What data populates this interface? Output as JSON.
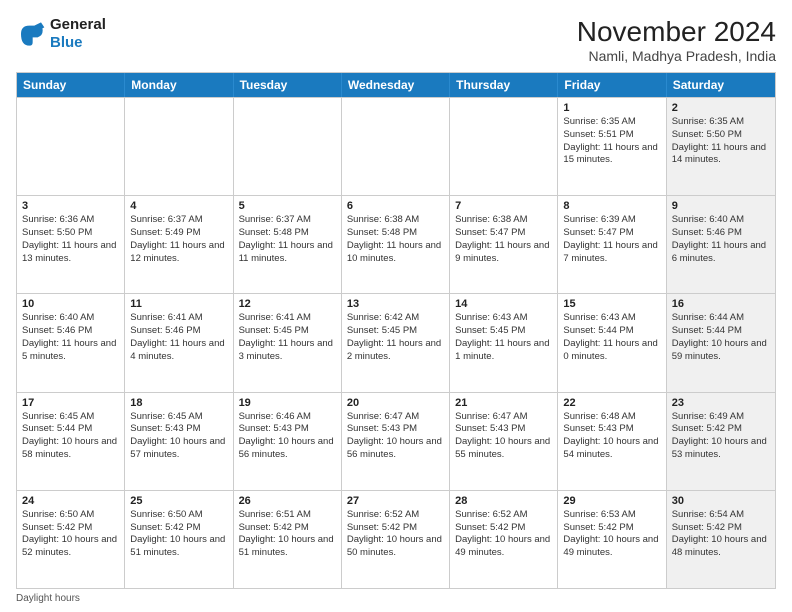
{
  "logo": {
    "line1": "General",
    "line2": "Blue"
  },
  "title": "November 2024",
  "subtitle": "Namli, Madhya Pradesh, India",
  "weekdays": [
    "Sunday",
    "Monday",
    "Tuesday",
    "Wednesday",
    "Thursday",
    "Friday",
    "Saturday"
  ],
  "weeks": [
    [
      {
        "day": "",
        "info": "",
        "shaded": false
      },
      {
        "day": "",
        "info": "",
        "shaded": false
      },
      {
        "day": "",
        "info": "",
        "shaded": false
      },
      {
        "day": "",
        "info": "",
        "shaded": false
      },
      {
        "day": "",
        "info": "",
        "shaded": false
      },
      {
        "day": "1",
        "info": "Sunrise: 6:35 AM\nSunset: 5:51 PM\nDaylight: 11 hours and 15 minutes.",
        "shaded": false
      },
      {
        "day": "2",
        "info": "Sunrise: 6:35 AM\nSunset: 5:50 PM\nDaylight: 11 hours and 14 minutes.",
        "shaded": true
      }
    ],
    [
      {
        "day": "3",
        "info": "Sunrise: 6:36 AM\nSunset: 5:50 PM\nDaylight: 11 hours and 13 minutes.",
        "shaded": false
      },
      {
        "day": "4",
        "info": "Sunrise: 6:37 AM\nSunset: 5:49 PM\nDaylight: 11 hours and 12 minutes.",
        "shaded": false
      },
      {
        "day": "5",
        "info": "Sunrise: 6:37 AM\nSunset: 5:48 PM\nDaylight: 11 hours and 11 minutes.",
        "shaded": false
      },
      {
        "day": "6",
        "info": "Sunrise: 6:38 AM\nSunset: 5:48 PM\nDaylight: 11 hours and 10 minutes.",
        "shaded": false
      },
      {
        "day": "7",
        "info": "Sunrise: 6:38 AM\nSunset: 5:47 PM\nDaylight: 11 hours and 9 minutes.",
        "shaded": false
      },
      {
        "day": "8",
        "info": "Sunrise: 6:39 AM\nSunset: 5:47 PM\nDaylight: 11 hours and 7 minutes.",
        "shaded": false
      },
      {
        "day": "9",
        "info": "Sunrise: 6:40 AM\nSunset: 5:46 PM\nDaylight: 11 hours and 6 minutes.",
        "shaded": true
      }
    ],
    [
      {
        "day": "10",
        "info": "Sunrise: 6:40 AM\nSunset: 5:46 PM\nDaylight: 11 hours and 5 minutes.",
        "shaded": false
      },
      {
        "day": "11",
        "info": "Sunrise: 6:41 AM\nSunset: 5:46 PM\nDaylight: 11 hours and 4 minutes.",
        "shaded": false
      },
      {
        "day": "12",
        "info": "Sunrise: 6:41 AM\nSunset: 5:45 PM\nDaylight: 11 hours and 3 minutes.",
        "shaded": false
      },
      {
        "day": "13",
        "info": "Sunrise: 6:42 AM\nSunset: 5:45 PM\nDaylight: 11 hours and 2 minutes.",
        "shaded": false
      },
      {
        "day": "14",
        "info": "Sunrise: 6:43 AM\nSunset: 5:45 PM\nDaylight: 11 hours and 1 minute.",
        "shaded": false
      },
      {
        "day": "15",
        "info": "Sunrise: 6:43 AM\nSunset: 5:44 PM\nDaylight: 11 hours and 0 minutes.",
        "shaded": false
      },
      {
        "day": "16",
        "info": "Sunrise: 6:44 AM\nSunset: 5:44 PM\nDaylight: 10 hours and 59 minutes.",
        "shaded": true
      }
    ],
    [
      {
        "day": "17",
        "info": "Sunrise: 6:45 AM\nSunset: 5:44 PM\nDaylight: 10 hours and 58 minutes.",
        "shaded": false
      },
      {
        "day": "18",
        "info": "Sunrise: 6:45 AM\nSunset: 5:43 PM\nDaylight: 10 hours and 57 minutes.",
        "shaded": false
      },
      {
        "day": "19",
        "info": "Sunrise: 6:46 AM\nSunset: 5:43 PM\nDaylight: 10 hours and 56 minutes.",
        "shaded": false
      },
      {
        "day": "20",
        "info": "Sunrise: 6:47 AM\nSunset: 5:43 PM\nDaylight: 10 hours and 56 minutes.",
        "shaded": false
      },
      {
        "day": "21",
        "info": "Sunrise: 6:47 AM\nSunset: 5:43 PM\nDaylight: 10 hours and 55 minutes.",
        "shaded": false
      },
      {
        "day": "22",
        "info": "Sunrise: 6:48 AM\nSunset: 5:43 PM\nDaylight: 10 hours and 54 minutes.",
        "shaded": false
      },
      {
        "day": "23",
        "info": "Sunrise: 6:49 AM\nSunset: 5:42 PM\nDaylight: 10 hours and 53 minutes.",
        "shaded": true
      }
    ],
    [
      {
        "day": "24",
        "info": "Sunrise: 6:50 AM\nSunset: 5:42 PM\nDaylight: 10 hours and 52 minutes.",
        "shaded": false
      },
      {
        "day": "25",
        "info": "Sunrise: 6:50 AM\nSunset: 5:42 PM\nDaylight: 10 hours and 51 minutes.",
        "shaded": false
      },
      {
        "day": "26",
        "info": "Sunrise: 6:51 AM\nSunset: 5:42 PM\nDaylight: 10 hours and 51 minutes.",
        "shaded": false
      },
      {
        "day": "27",
        "info": "Sunrise: 6:52 AM\nSunset: 5:42 PM\nDaylight: 10 hours and 50 minutes.",
        "shaded": false
      },
      {
        "day": "28",
        "info": "Sunrise: 6:52 AM\nSunset: 5:42 PM\nDaylight: 10 hours and 49 minutes.",
        "shaded": false
      },
      {
        "day": "29",
        "info": "Sunrise: 6:53 AM\nSunset: 5:42 PM\nDaylight: 10 hours and 49 minutes.",
        "shaded": false
      },
      {
        "day": "30",
        "info": "Sunrise: 6:54 AM\nSunset: 5:42 PM\nDaylight: 10 hours and 48 minutes.",
        "shaded": true
      }
    ]
  ],
  "footer": "Daylight hours"
}
